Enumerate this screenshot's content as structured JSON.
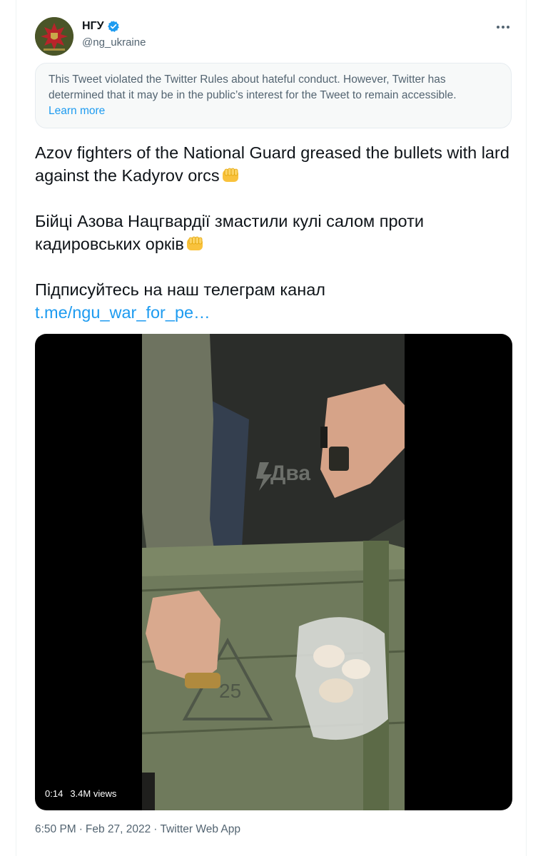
{
  "author": {
    "display_name": "НГУ",
    "handle": "@ng_ukraine",
    "verified": true
  },
  "icons": {
    "verified": "verified-badge-icon",
    "more": "more-dots-icon",
    "emoji": "oncoming-fist-emoji"
  },
  "notice": {
    "text": "This Tweet violated the Twitter Rules about hateful conduct. However, Twitter has determined that it may be in the public’s interest for the Tweet to remain accessible.",
    "link": "Learn more"
  },
  "body": {
    "en": "Azov fighters of the National Guard greased the bullets with lard against the Kadyrov orcs",
    "ua": "Бійці Азова Нацгвардії змастили кулі салом проти кадировських орків",
    "subscribe": "Підписуйтесь на наш телеграм канал",
    "link": "t.me/ngu_war_for_pe…"
  },
  "video": {
    "duration": "0:14",
    "views": "3.4M views",
    "overlay_text": "Два"
  },
  "meta": {
    "time": "6:50 PM",
    "date": "Feb 27, 2022",
    "source": "Twitter Web App"
  },
  "colors": {
    "accent": "#1d9bf0",
    "secondary_text": "#536471",
    "primary_text": "#0f1419"
  }
}
